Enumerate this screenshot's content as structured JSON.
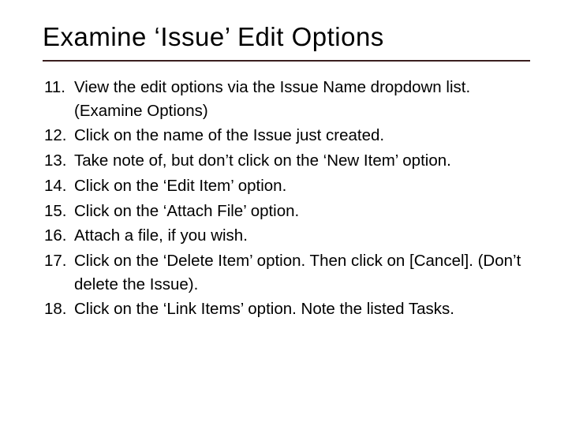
{
  "title": "Examine ‘Issue’ Edit Options",
  "items": [
    {
      "num": "11.",
      "text": "View the edit options via the Issue Name dropdown list.  (Examine Options)"
    },
    {
      "num": "12.",
      "text": "Click on the name of the Issue just created."
    },
    {
      "num": "13.",
      "text": "Take note of, but don’t click on the ‘New Item’ option."
    },
    {
      "num": "14.",
      "text": "Click on the ‘Edit Item’ option."
    },
    {
      "num": "15.",
      "text": "Click on the ‘Attach File’ option."
    },
    {
      "num": "16.",
      "text": "Attach a file, if you wish."
    },
    {
      "num": "17.",
      "text": "Click on the ‘Delete Item’ option. Then click on [Cancel]. (Don’t delete the Issue)."
    },
    {
      "num": "18.",
      "text": "Click on the ‘Link Items’ option. Note the listed Tasks."
    }
  ]
}
